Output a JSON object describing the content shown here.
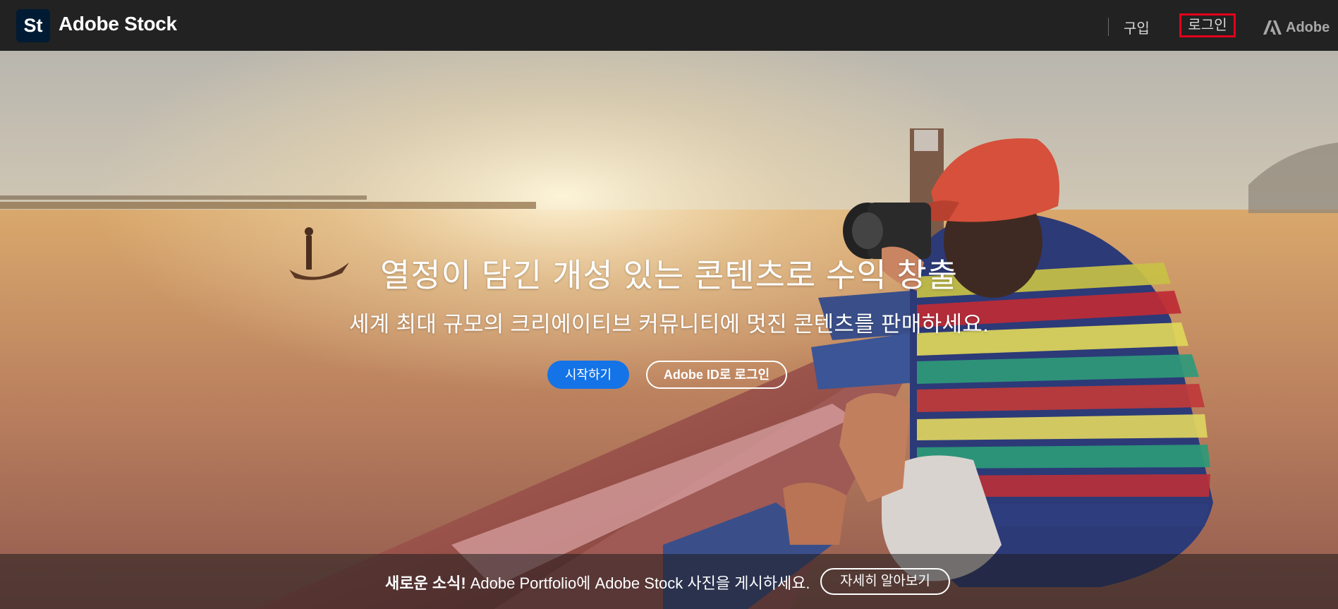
{
  "header": {
    "logo_mark": "St",
    "brand": "Adobe Stock",
    "nav": {
      "buy": "구입",
      "login": "로그인"
    },
    "adobe_label": "Adobe",
    "login_highlight_color": "#e3001b"
  },
  "hero": {
    "headline": "열정이 담긴 개성 있는 콘텐츠로 수익 창출",
    "subhead": "세계 최대 규모의 크리에이티브 커뮤니티에 멋진 콘텐츠를 판매하세요.",
    "cta_primary": "시작하기",
    "cta_secondary": "Adobe ID로 로그인",
    "accent_color": "#1473e6"
  },
  "banner": {
    "strong": "새로운 소식!",
    "text": " Adobe Portfolio에 Adobe Stock 사진을 게시하세요.",
    "cta": "자세히 알아보기"
  }
}
